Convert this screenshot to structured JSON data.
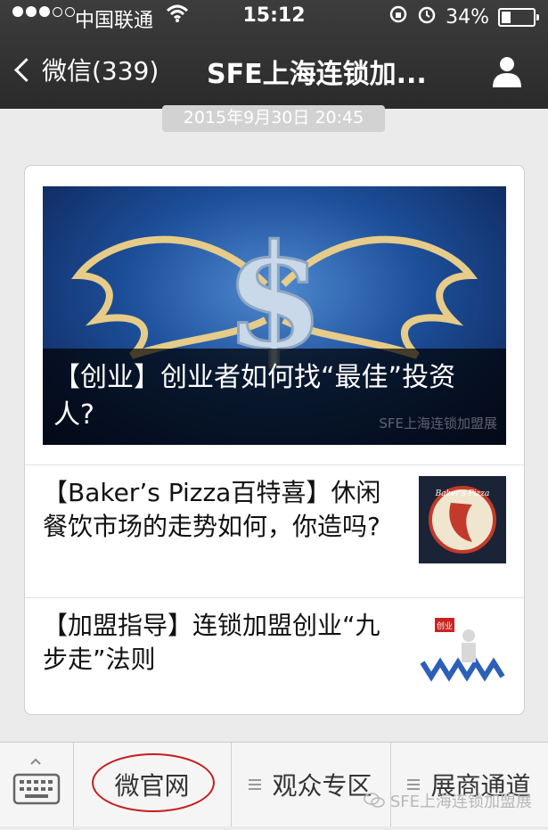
{
  "status": {
    "carrier": "中国联通",
    "time": "15:12",
    "battery": "34%",
    "battery_level": 0.34
  },
  "nav": {
    "back_label": "微信(339)",
    "title": "SFE上海连锁加..."
  },
  "message": {
    "timestamp": "2015年9月30日 20:45"
  },
  "articles": {
    "main": {
      "title": "【创业】创业者如何找“最佳”投资人?",
      "watermark": "SFE上海连锁加盟展"
    },
    "items": [
      {
        "title": "【Baker’s Pizza百特喜】休闲餐饮市场的走势如何，你造吗?",
        "thumb": "Baker's Pizza"
      },
      {
        "title": "【加盟指导】连锁加盟创业“九步走”法则",
        "thumb": "创业"
      }
    ]
  },
  "menu": {
    "items": [
      {
        "label": "微官网"
      },
      {
        "label": "观众专区"
      },
      {
        "label": "展商通道"
      }
    ]
  },
  "watermark": "SFE上海连锁加盟展",
  "colors": {
    "topbar": "#2f2f2f",
    "annotation_red": "#c51d1d"
  }
}
